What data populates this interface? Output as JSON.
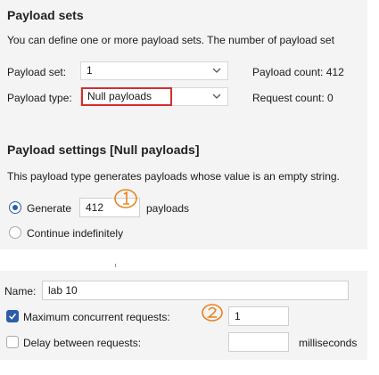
{
  "payload_sets": {
    "heading": "Payload sets",
    "description": "You can define one or more payload sets. The number of payload set",
    "set_label": "Payload set:",
    "set_value": "1",
    "type_label": "Payload type:",
    "type_value": "Null payloads",
    "count_label": "Payload count: 412",
    "request_count_label": "Request count: 0"
  },
  "payload_settings": {
    "heading": "Payload settings [Null payloads]",
    "description": "This payload type generates payloads whose value is an empty string.",
    "generate_label": "Generate",
    "generate_value": "412",
    "generate_suffix": "payloads",
    "generate_selected": true,
    "continue_label": "Continue indefinitely"
  },
  "resource_pool": {
    "name_label": "Name:",
    "name_value": "lab 10",
    "max_concurrent_label": "Maximum concurrent requests:",
    "max_concurrent_value": "1",
    "max_concurrent_checked": true,
    "delay_label": "Delay between requests:",
    "delay_value": "",
    "delay_unit": "milliseconds",
    "delay_checked": false
  },
  "annotations": {
    "marker_1": "①",
    "marker_2": "②"
  },
  "colors": {
    "accent_blue": "#2b5ea7",
    "highlight_red": "#d32f2f",
    "annotation_orange": "#e8821e"
  }
}
